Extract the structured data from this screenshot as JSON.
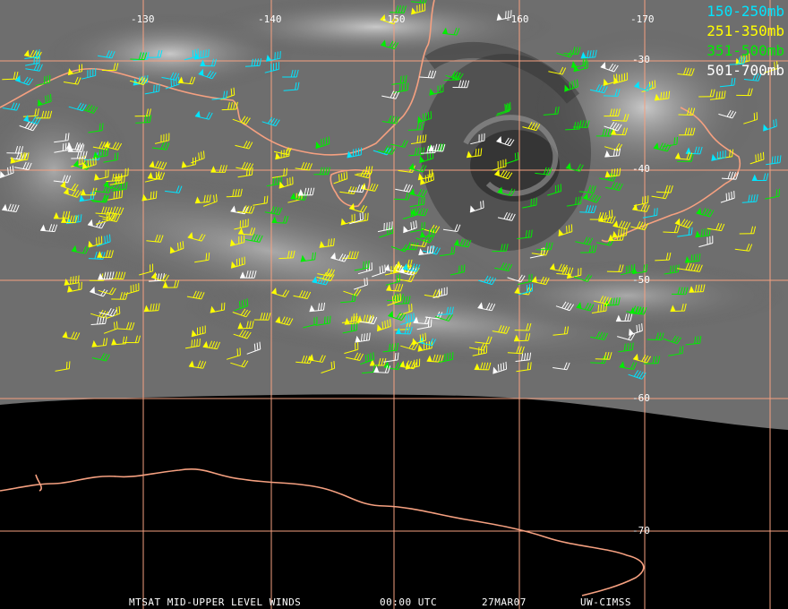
{
  "map": {
    "longitude_labels": [
      "-130",
      "-140",
      "-150",
      "-160",
      "-170"
    ],
    "latitude_labels": [
      "-30",
      "-40",
      "-50",
      "-60",
      "-70"
    ]
  },
  "legend": {
    "items": [
      {
        "label": "150-250mb",
        "color": "#00e5ff"
      },
      {
        "label": "251-350mb",
        "color": "#ffff00"
      },
      {
        "label": "351-500mb",
        "color": "#00ee00"
      },
      {
        "label": "501-700mb",
        "color": "#ffffff"
      }
    ]
  },
  "footer": {
    "product": "MTSAT MID-UPPER LEVEL WINDS",
    "time": "00:00 UTC",
    "date": "27MAR07",
    "source": "UW-CIMSS"
  },
  "colors": {
    "coastline": "#f5a080",
    "gridline": "#f5a080",
    "background": "#000000"
  }
}
